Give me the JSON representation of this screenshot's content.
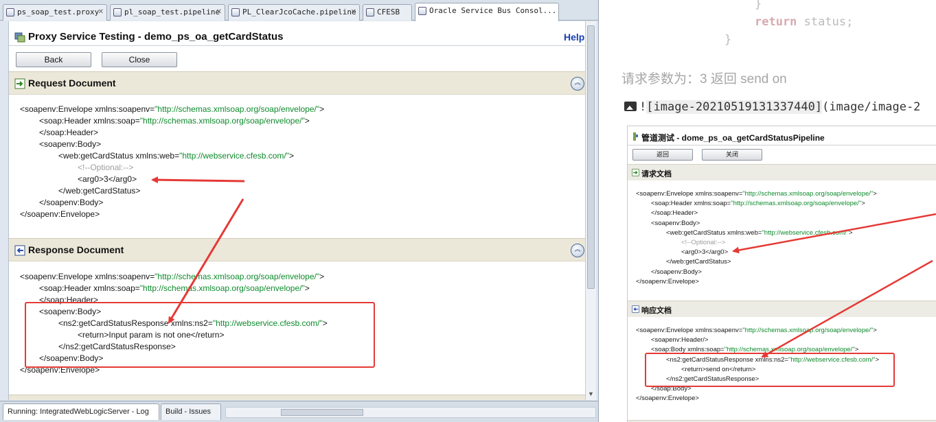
{
  "ide": {
    "tabs": [
      {
        "label": "ps_soap_test.proxy"
      },
      {
        "label": "pl_soap_test.pipeline"
      },
      {
        "label": "PL_ClearJcoCache.pipeline"
      },
      {
        "label": "CFESB"
      },
      {
        "label": "Oracle Service Bus Consol..."
      }
    ],
    "page_title": "Proxy Service Testing - demo_ps_oa_getCardStatus",
    "help_label": "Help",
    "back_label": "Back",
    "close_label": "Close",
    "request_title": "Request Document",
    "response_title": "Response Document",
    "request_xml": [
      {
        "tag": "<soapenv:Envelope ",
        "attr": "xmlns:soapenv=",
        "val": "\"http://schemas.xmlsoap.org/soap/envelope/\"",
        "end": ">"
      },
      {
        "tag": "<soap:Header ",
        "attr": "xmlns:soap=",
        "val": "\"http://schemas.xmlsoap.org/soap/envelope/\"",
        "end": ">"
      },
      {
        "tag": "</soap:Header>",
        "attr": "",
        "val": "",
        "end": ""
      },
      {
        "tag": "<soapenv:Body>",
        "attr": "",
        "val": "",
        "end": ""
      },
      {
        "tag": "<web:getCardStatus ",
        "attr": "xmlns:web=",
        "val": "\"http://webservice.cfesb.com/\"",
        "end": ">"
      },
      {
        "comment": "<!--Optional:-->"
      },
      {
        "tag": "<arg0>3</arg0>",
        "attr": "",
        "val": "",
        "end": ""
      },
      {
        "tag": "</web:getCardStatus>",
        "attr": "",
        "val": "",
        "end": ""
      },
      {
        "tag": "</soapenv:Body>",
        "attr": "",
        "val": "",
        "end": ""
      },
      {
        "tag": "</soapenv:Envelope>",
        "attr": "",
        "val": "",
        "end": ""
      }
    ],
    "response_xml": [
      {
        "tag": "<soapenv:Envelope ",
        "attr": "xmlns:soapenv=",
        "val": "\"http://schemas.xmlsoap.org/soap/envelope/\"",
        "end": ">"
      },
      {
        "tag": "<soap:Header ",
        "attr": "xmlns:soap=",
        "val": "\"http://schemas.xmlsoap.org/soap/envelope/\"",
        "end": ">"
      },
      {
        "tag": "</soap:Header>",
        "attr": "",
        "val": "",
        "end": ""
      },
      {
        "tag": "<soapenv:Body>",
        "attr": "",
        "val": "",
        "end": ""
      },
      {
        "tag": "<ns2:getCardStatusResponse ",
        "attr": "xmlns:ns2=",
        "val": "\"http://webservice.cfesb.com/\"",
        "end": ">"
      },
      {
        "tag": "<return>Input param is not one</return>",
        "attr": "",
        "val": "",
        "end": ""
      },
      {
        "tag": "</ns2:getCardStatusResponse>",
        "attr": "",
        "val": "",
        "end": ""
      },
      {
        "tag": "</soapenv:Body>",
        "attr": "",
        "val": "",
        "end": ""
      },
      {
        "tag": "</soapenv:Envelope>",
        "attr": "",
        "val": "",
        "end": ""
      }
    ],
    "bottom_tabs": [
      {
        "label": "Running: IntegratedWebLogicServer - Log"
      },
      {
        "label": "Build - Issues"
      }
    ]
  },
  "blog": {
    "code_brace_1": "}",
    "code_return_kw": "return",
    "code_return_rest": " status;",
    "code_brace_2": "}",
    "note": "请求参数为：3  返回 send on",
    "image_link_prefix": "!",
    "image_link_alt": "[image-20210519131337440]",
    "image_link_path": "(image/image-2",
    "inner": {
      "title": "管道测试 - dome_ps_oa_getCardStatusPipeline",
      "back_label": "返回",
      "close_label": "关闭",
      "request_title": "请求文档",
      "response_title": "响应文档",
      "request_xml": [
        {
          "tag": "<soapenv:Envelope ",
          "attr": "xmlns:soapenv=",
          "val": "\"http://schemas.xmlsoap.org/soap/envelope/\"",
          "end": ">"
        },
        {
          "tag": "<soap:Header ",
          "attr": "xmlns:soap=",
          "val": "\"http://schemas.xmlsoap.org/soap/envelope/\"",
          "end": ">"
        },
        {
          "tag": "</soap:Header>",
          "attr": "",
          "val": "",
          "end": ""
        },
        {
          "tag": "<soapenv:Body>",
          "attr": "",
          "val": "",
          "end": ""
        },
        {
          "tag": "<web:getCardStatus ",
          "attr": "xmlns:web=",
          "val": "\"http://webservice.cfesb.com/\"",
          "end": ">"
        },
        {
          "comment": "<!--Optional:-->"
        },
        {
          "tag": "<arg0>3</arg0>",
          "attr": "",
          "val": "",
          "end": ""
        },
        {
          "tag": "</web:getCardStatus>",
          "attr": "",
          "val": "",
          "end": ""
        },
        {
          "tag": "</soapenv:Body>",
          "attr": "",
          "val": "",
          "end": ""
        },
        {
          "tag": "</soapenv:Envelope>",
          "attr": "",
          "val": "",
          "end": ""
        }
      ],
      "response_xml": [
        {
          "tag": "<soapenv:Envelope ",
          "attr": "xmlns:soapenv=",
          "val": "\"http://schemas.xmlsoap.org/soap/envelope/\"",
          "end": ">"
        },
        {
          "tag": "<soapenv:Header/>",
          "attr": "",
          "val": "",
          "end": ""
        },
        {
          "tag": "<soap:Body ",
          "attr": "xmlns:soap=",
          "val": "\"http://schemas.xmlsoap.org/soap/envelope/\"",
          "end": ">"
        },
        {
          "tag": "<ns2:getCardStatusResponse ",
          "attr": "xmlns:ns2=",
          "val": "\"http://webservice.cfesb.com/\"",
          "end": ">"
        },
        {
          "tag": "<return>send on</return>",
          "attr": "",
          "val": "",
          "end": ""
        },
        {
          "tag": "</ns2:getCardStatusResponse>",
          "attr": "",
          "val": "",
          "end": ""
        },
        {
          "tag": "</soap:Body>",
          "attr": "",
          "val": "",
          "end": ""
        },
        {
          "tag": "</soapenv:Envelope>",
          "attr": "",
          "val": "",
          "end": ""
        }
      ]
    }
  },
  "colors": {
    "annotation_red": "#e53935",
    "xml_attr_value": "#0d8a2b",
    "xml_comment": "#9c9c9c",
    "help_link": "#1a3fb3"
  },
  "icons": [
    "proxy-service-icon",
    "request-arrow-icon",
    "response-arrow-icon",
    "collapse-chevron-icon",
    "image-icon",
    "pipeline-icon"
  ]
}
